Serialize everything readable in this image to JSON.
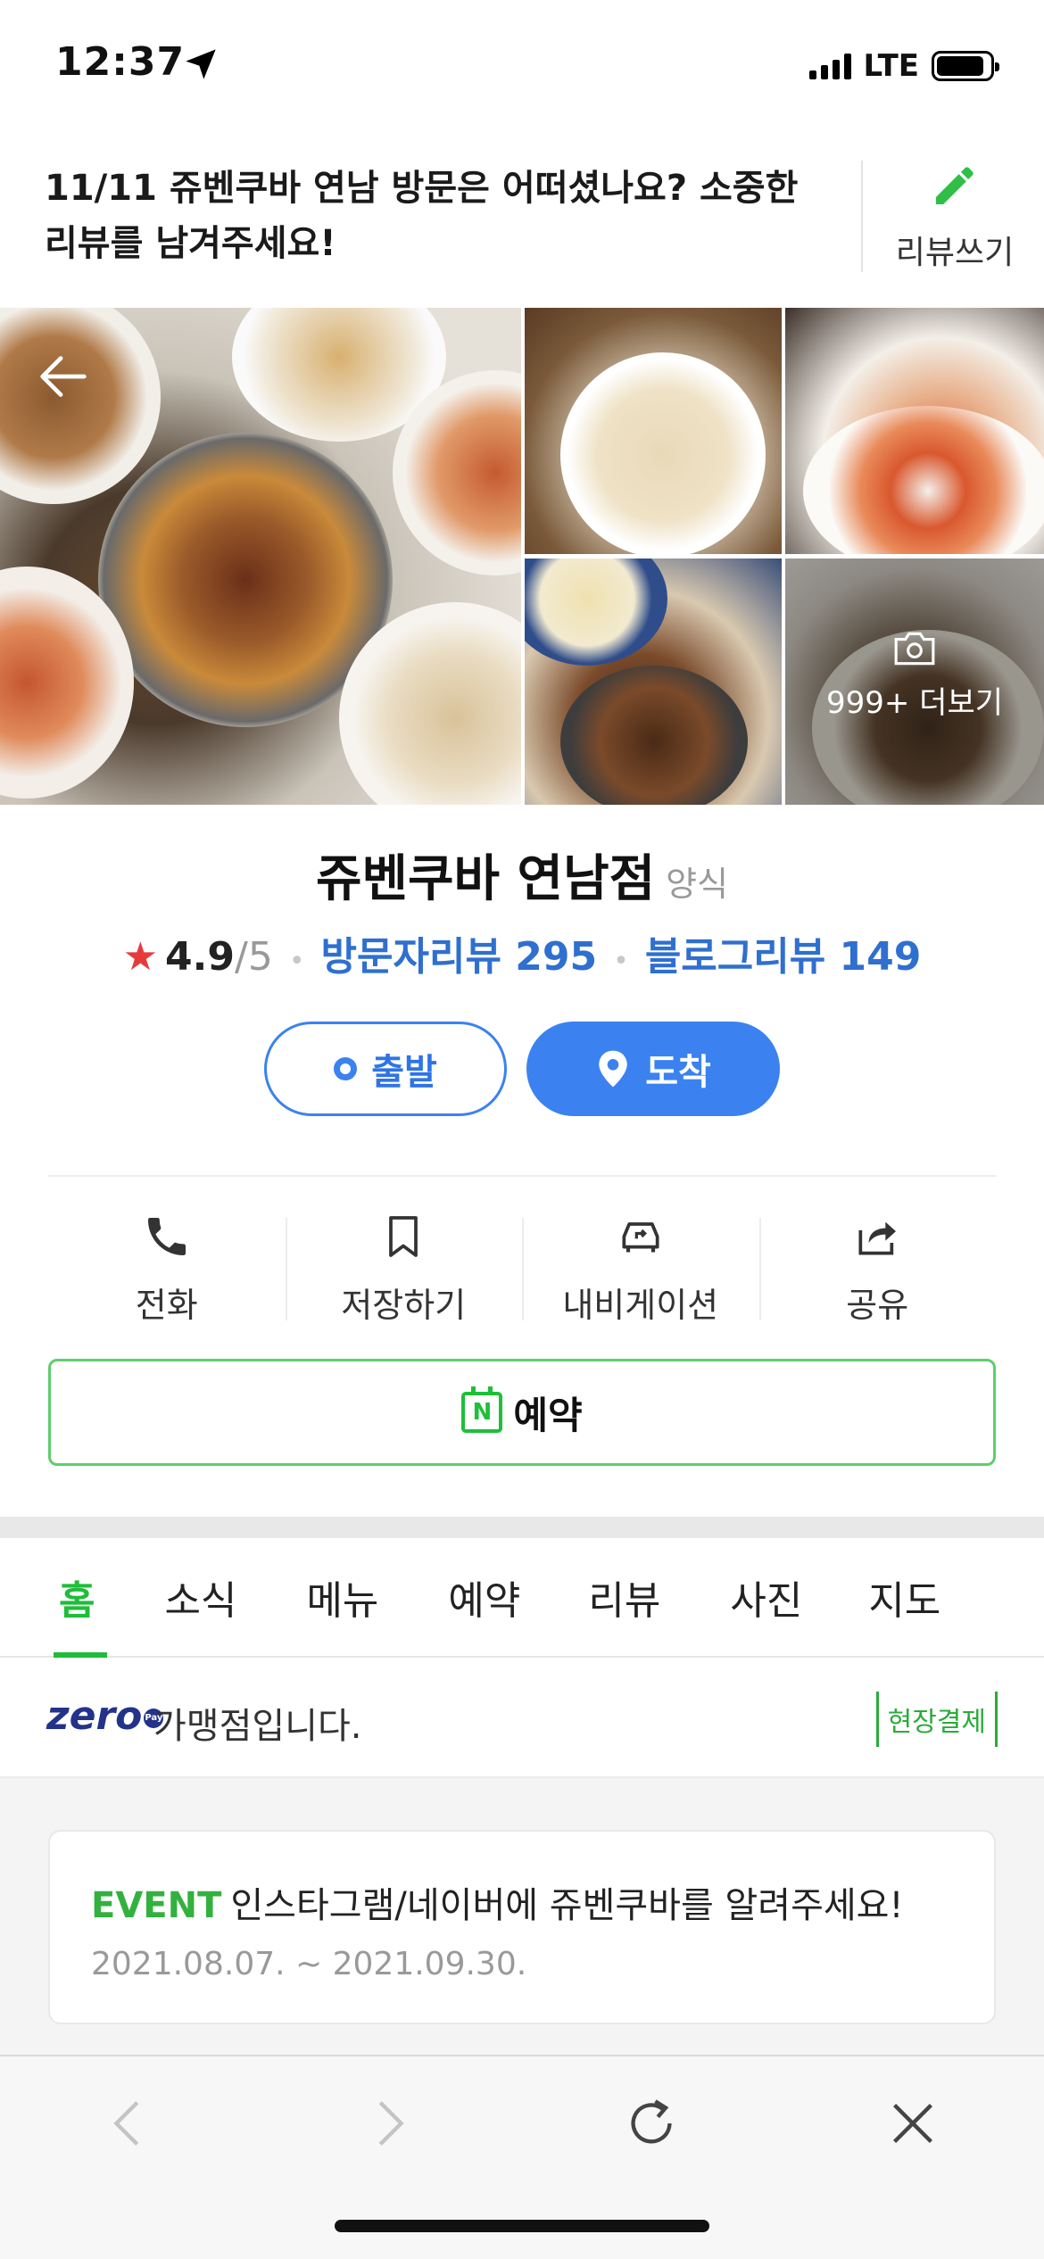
{
  "status_bar": {
    "time": "12:37",
    "network": "LTE"
  },
  "review_banner": {
    "text": "11/11 쥬벤쿠바 연남 방문은 어떠셨나요? 소중한 리뷰를 남겨주세요!",
    "write_label": "리뷰쓰기"
  },
  "photos": {
    "more_label": "999+ 더보기"
  },
  "place": {
    "name": "쥬벤쿠바 연남점",
    "category": "양식",
    "rating": "4.9",
    "rating_max": "/5",
    "visitor_reviews": "방문자리뷰 295",
    "blog_reviews": "블로그리뷰 149"
  },
  "route": {
    "depart": "출발",
    "arrive": "도착"
  },
  "actions": {
    "call": "전화",
    "save": "저장하기",
    "navigation": "내비게이션",
    "share": "공유"
  },
  "reserve": {
    "label": "예약",
    "icon_letter": "N"
  },
  "tabs": [
    "홈",
    "소식",
    "메뉴",
    "예약",
    "리뷰",
    "사진",
    "지도"
  ],
  "zeropay": {
    "logo": "zero",
    "pay_mark": "Pay",
    "text": "가맹점입니다.",
    "badge": "현장결제"
  },
  "event": {
    "tag": "EVENT",
    "title": "인스타그램/네이버에 쥬벤쿠바를 알려주세요!",
    "date": "2021.08.07. ~ 2021.09.30."
  },
  "colors": {
    "accent_green": "#1fbd3a",
    "accent_blue": "#3b82f0",
    "star": "#e53b3b"
  }
}
